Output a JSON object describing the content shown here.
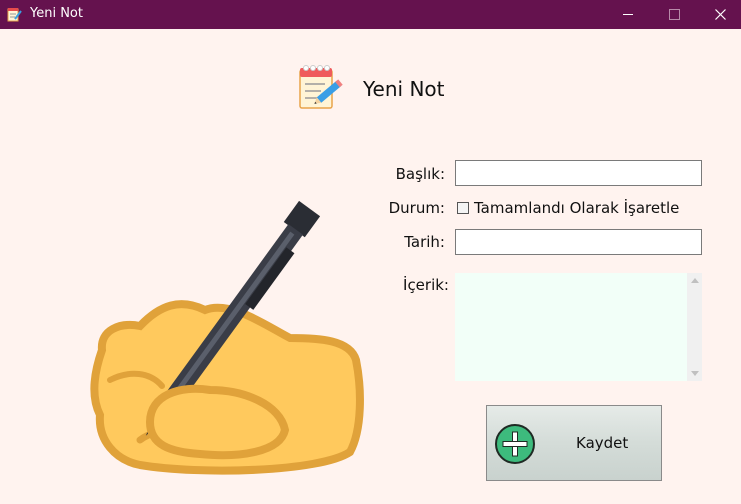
{
  "window": {
    "title": "Yeni Not"
  },
  "header": {
    "title": "Yeni Not"
  },
  "form": {
    "title_label": "Başlık:",
    "title_value": "",
    "status_label": "Durum:",
    "completed_checkbox_label": "Tamamlandı Olarak İşaretle",
    "completed_checked": false,
    "date_label": "Tarih:",
    "date_value": "",
    "content_label": "İçerik:",
    "content_value": ""
  },
  "buttons": {
    "save_label": "Kaydet"
  },
  "colors": {
    "titlebar": "#65124e",
    "background": "#fff3ef",
    "content_bg": "#f2fff8",
    "accent_green": "#3dbb7d"
  },
  "icons": {
    "app": "notepad-pen-icon",
    "header": "notepad-pen-icon",
    "save": "plus-circle-icon",
    "illustration": "writing-hand-icon"
  }
}
